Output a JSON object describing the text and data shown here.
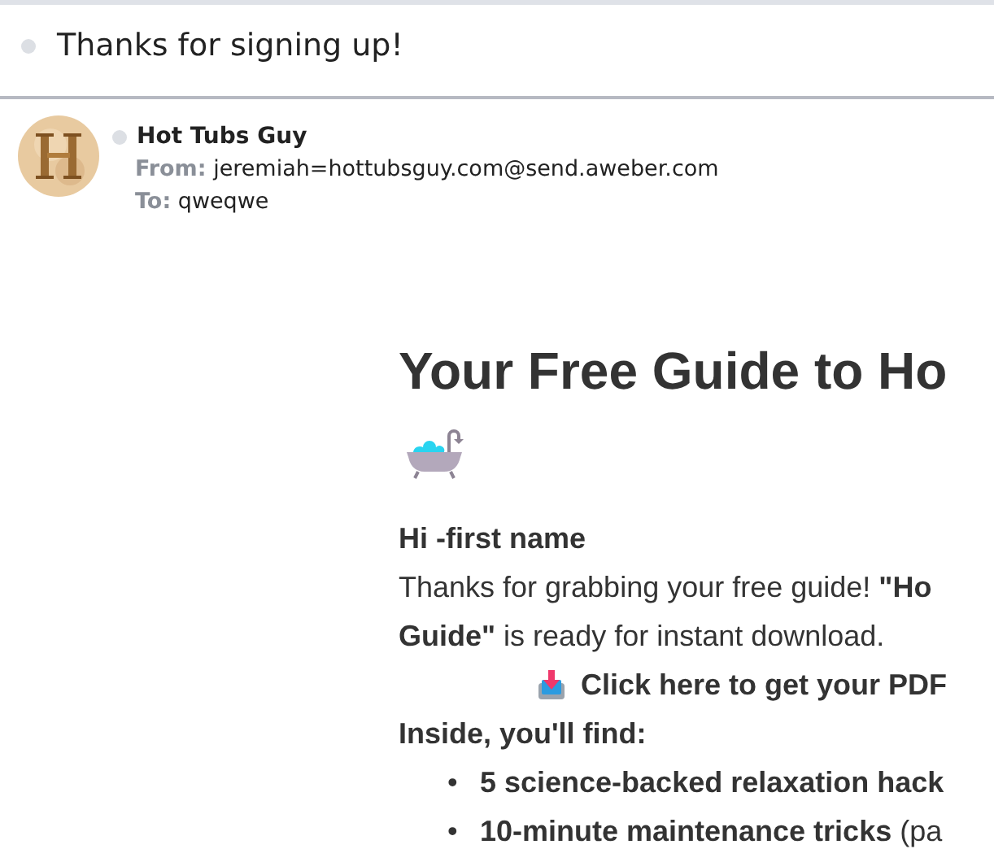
{
  "subject": "Thanks for signing up!",
  "sender": {
    "name": "Hot Tubs Guy",
    "from_label": "From:",
    "from": "jeremiah=hottubsguy.com@send.aweber.com",
    "to_label": "To:",
    "to": "qweqwe"
  },
  "body": {
    "heading": "Your Free Guide to Ho",
    "greeting": "Hi -first name",
    "paragraph_lines": [
      "Thanks for grabbing your free guide! **\"Ho**",
      "**Guide\"** is ready for instant download."
    ],
    "download_link": "Click here to get your PDF",
    "list_intro": "Inside, you'll find:",
    "bullets": [
      {
        "marker": "•",
        "text": "**5 science-backed relaxation hack**"
      },
      {
        "marker": "•",
        "text": "**10-minute maintenance tricks** (pa"
      }
    ]
  }
}
